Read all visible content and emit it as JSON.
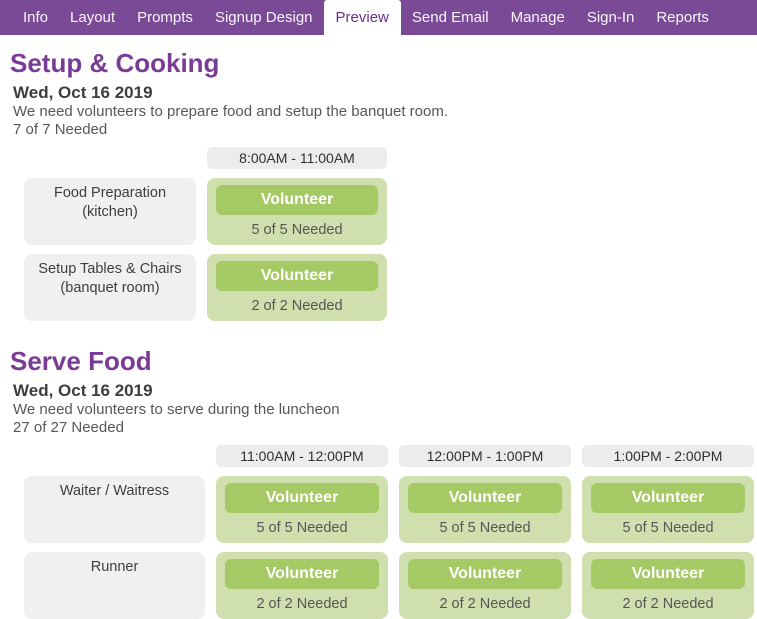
{
  "labels": {
    "volunteer_button": "Volunteer"
  },
  "nav": {
    "items": [
      {
        "label": "Info",
        "active": false
      },
      {
        "label": "Layout",
        "active": false
      },
      {
        "label": "Prompts",
        "active": false
      },
      {
        "label": "Signup Design",
        "active": false
      },
      {
        "label": "Preview",
        "active": true
      },
      {
        "label": "Send Email",
        "active": false
      },
      {
        "label": "Manage",
        "active": false
      },
      {
        "label": "Sign-In",
        "active": false
      },
      {
        "label": "Reports",
        "active": false
      }
    ]
  },
  "sections": [
    {
      "title": "Setup & Cooking",
      "date": "Wed, Oct 16 2019",
      "description": "We need volunteers to prepare food and setup the banquet room.",
      "needed_summary": "7 of 7 Needed",
      "time_slots": [
        "8:00AM - 11:00AM"
      ],
      "rows": [
        {
          "label_line1": "Food Preparation",
          "label_line2": "(kitchen)",
          "cells": [
            {
              "needed": "5 of 5 Needed"
            }
          ]
        },
        {
          "label_line1": "Setup Tables & Chairs",
          "label_line2": "(banquet room)",
          "cells": [
            {
              "needed": "2 of 2 Needed"
            }
          ]
        }
      ]
    },
    {
      "title": "Serve Food",
      "date": "Wed, Oct 16 2019",
      "description": "We need volunteers to serve during the luncheon",
      "needed_summary": "27 of 27 Needed",
      "time_slots": [
        "11:00AM - 12:00PM",
        "12:00PM - 1:00PM",
        "1:00PM - 2:00PM"
      ],
      "rows": [
        {
          "label_line1": "Waiter / Waitress",
          "label_line2": "",
          "cells": [
            {
              "needed": "5 of 5 Needed"
            },
            {
              "needed": "5 of 5 Needed"
            },
            {
              "needed": "5 of 5 Needed"
            }
          ]
        },
        {
          "label_line1": "Runner",
          "label_line2": "",
          "cells": [
            {
              "needed": "2 of 2 Needed"
            },
            {
              "needed": "2 of 2 Needed"
            },
            {
              "needed": "2 of 2 Needed"
            }
          ]
        }
      ]
    }
  ],
  "colors": {
    "nav_bg": "#7b4a97",
    "active_tab_text": "#6a2d90",
    "section_heading": "#7a3b96",
    "button_green": "#a5c964",
    "slot_bg_green": "#cfdfae",
    "label_cell_gray": "#f0f0f0",
    "time_header_gray": "#ececec"
  }
}
